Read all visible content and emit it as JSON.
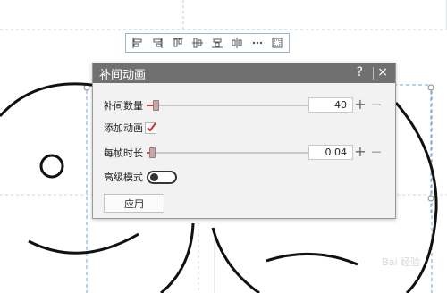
{
  "colors": {
    "accent": "#cc3333",
    "titlebar": "#707070",
    "guide": "#7aa6d8"
  },
  "toolbar": {
    "icons": [
      "align-left-icon",
      "align-right-icon",
      "align-top-icon",
      "align-center-vertical-icon",
      "align-bottom-icon",
      "align-center-horizontal-icon",
      "distribute-icon",
      "fit-icon"
    ]
  },
  "dialog": {
    "title": "补间动画",
    "help": "?",
    "close": "×",
    "tween_count": {
      "label": "补间数量",
      "value": "40",
      "slider_fraction": 0.04
    },
    "add_animation": {
      "label": "添加动画",
      "checked": true
    },
    "frame_duration": {
      "label": "每帧时长",
      "value": "0.04",
      "slider_fraction": 0.02
    },
    "advanced_mode": {
      "label": "高级模式",
      "on": false
    },
    "apply_label": "应用"
  },
  "stepper_symbols": {
    "plus": "+",
    "minus": "—"
  },
  "watermark": "Bai 经验"
}
